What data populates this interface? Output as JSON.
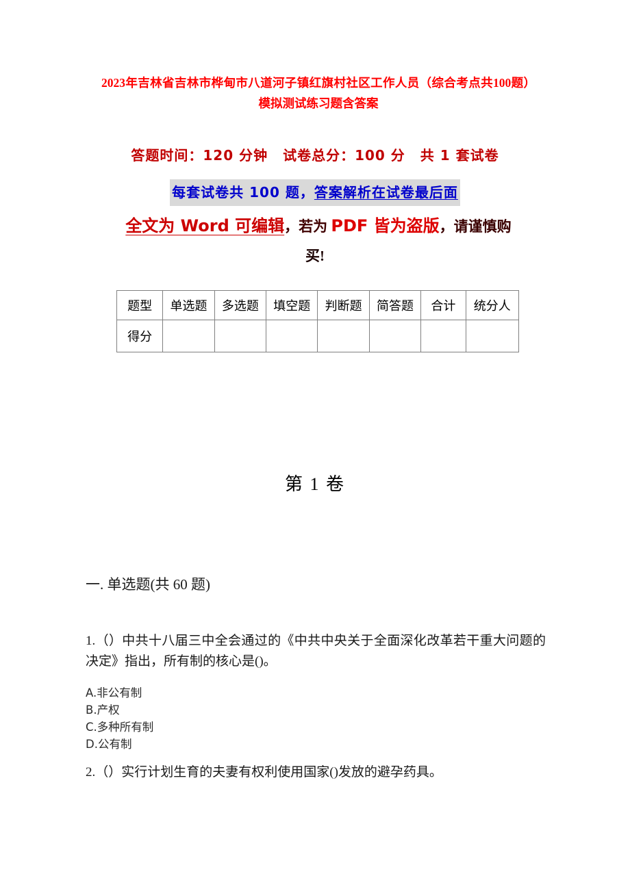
{
  "document": {
    "title": "2023年吉林省吉林市桦甸市八道河子镇红旗村社区工作人员（综合考点共100题）模拟测试练习题含答案",
    "colors": {
      "title_red": "#FF0000",
      "meta_red": "#C00000",
      "meta_blue": "#0000CC",
      "highlight_gray": "#D9D9D9",
      "warn_red": "#CC0000",
      "warn_dark": "#400000",
      "table_border": "#808080"
    }
  },
  "exam_info": {
    "time_label": "答题时间：120 分钟",
    "total_score_label": "试卷总分：100 分",
    "paper_count_label": "共 1 套试卷",
    "highlight_part1": "每套试卷共 100 题，",
    "highlight_part2": "答案解析在试卷最后面"
  },
  "warning": {
    "part_red_underline": "全文为 Word 可编辑",
    "part_dark_1": "，若为 ",
    "part_red_2": "PDF 皆为盗版",
    "part_dark_2": "，请谨慎购",
    "last_line": "买!"
  },
  "score_table": {
    "headers": [
      "题型",
      "单选题",
      "多选题",
      "填空题",
      "判断题",
      "简答题",
      "合计",
      "统分人"
    ],
    "row_label": "得分",
    "row_values": [
      "",
      "",
      "",
      "",
      "",
      "",
      ""
    ]
  },
  "volume": {
    "heading": "第 1 卷"
  },
  "sections": {
    "single_choice_heading": "一. 单选题(共 60 题)"
  },
  "questions": [
    {
      "number": "1.",
      "text": "1.（）中共十八届三中全会通过的《中共中央关于全面深化改革若干重大问题的决定》指出，所有制的核心是()。",
      "options": [
        "A.非公有制",
        "B.产权",
        "C.多种所有制",
        "D.公有制"
      ]
    },
    {
      "number": "2.",
      "text": "2.（）实行计划生育的夫妻有权利使用国家()发放的避孕药具。",
      "options": []
    }
  ]
}
